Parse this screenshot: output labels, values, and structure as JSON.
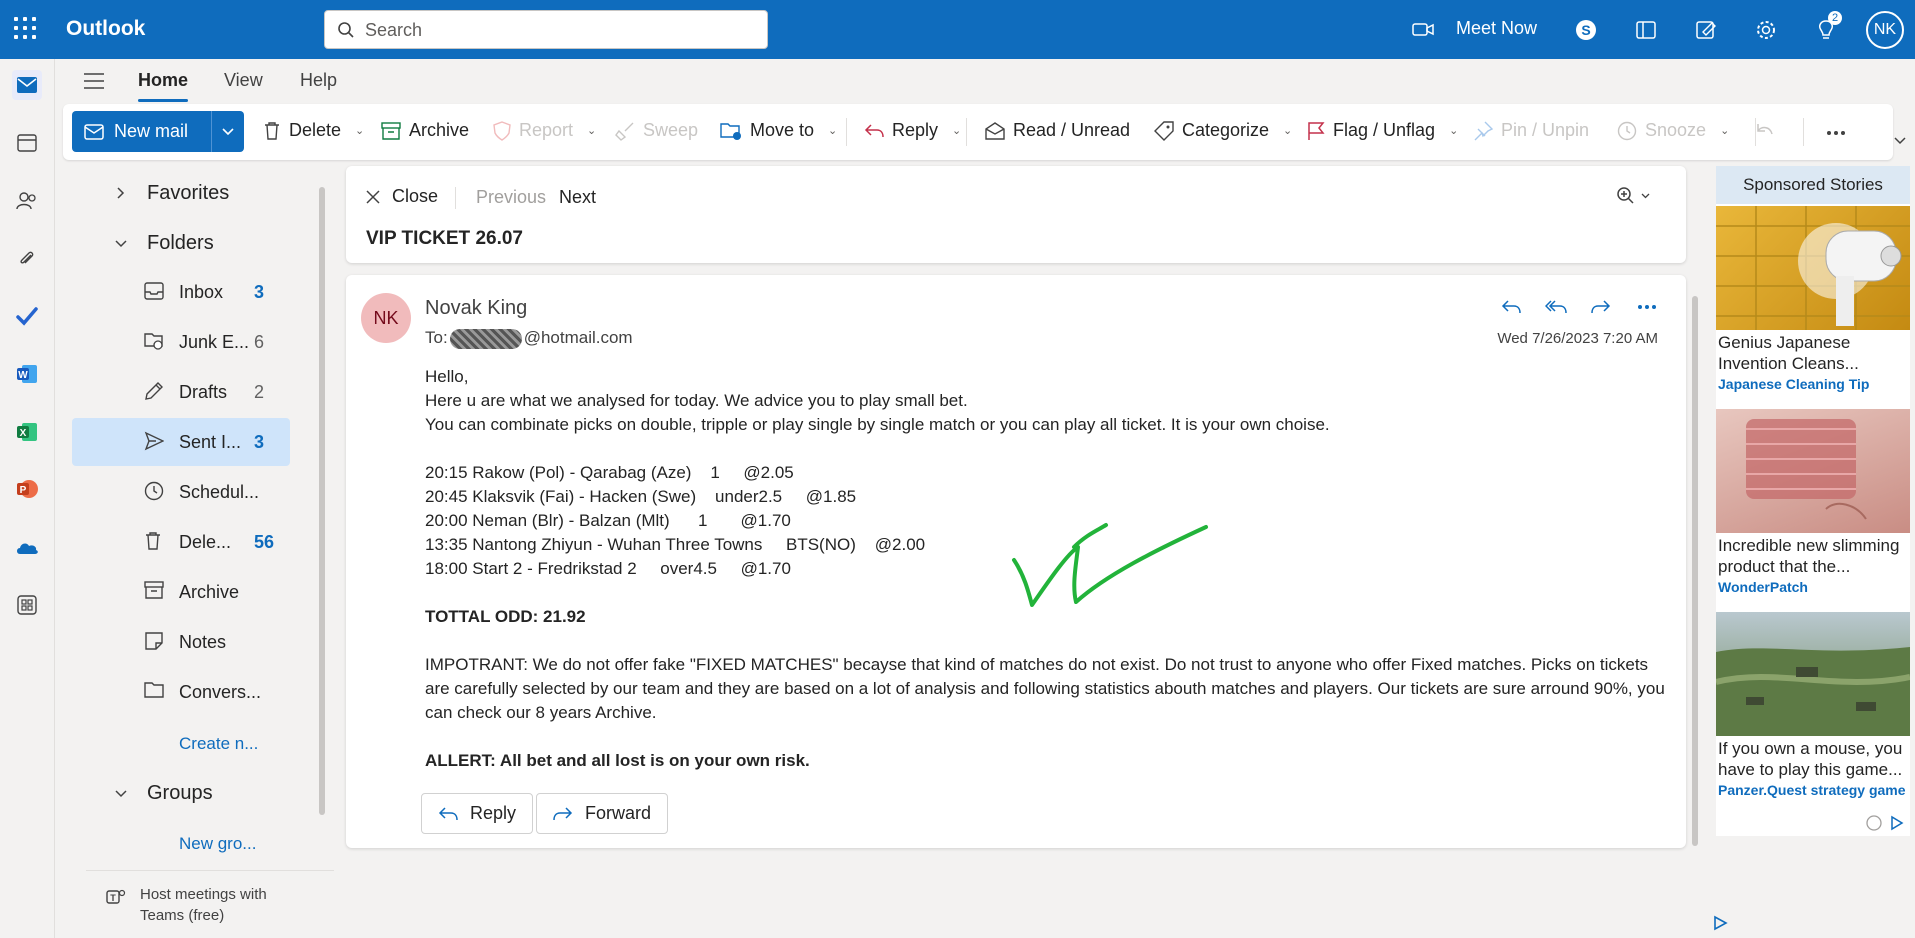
{
  "app": {
    "name": "Outlook"
  },
  "search": {
    "placeholder": "Search"
  },
  "topbar": {
    "meet_now": "Meet Now",
    "notification_count": "2",
    "user_initials": "NK"
  },
  "tabs": [
    "Home",
    "View",
    "Help"
  ],
  "ribbon": {
    "new_mail": "New mail",
    "delete": "Delete",
    "archive": "Archive",
    "report": "Report",
    "sweep": "Sweep",
    "move_to": "Move to",
    "reply": "Reply",
    "read_unread": "Read / Unread",
    "categorize": "Categorize",
    "flag": "Flag / Unflag",
    "pin": "Pin / Unpin",
    "snooze": "Snooze"
  },
  "folders": {
    "favorites": "Favorites",
    "folders_label": "Folders",
    "items": [
      {
        "label": "Inbox",
        "count": "3"
      },
      {
        "label": "Junk E...",
        "count": "6"
      },
      {
        "label": "Drafts",
        "count": "2"
      },
      {
        "label": "Sent I...",
        "count": "3"
      },
      {
        "label": "Schedul...",
        "count": ""
      },
      {
        "label": "Dele...",
        "count": "56"
      },
      {
        "label": "Archive",
        "count": ""
      },
      {
        "label": "Notes",
        "count": ""
      },
      {
        "label": "Convers...",
        "count": ""
      }
    ],
    "create_new": "Create n...",
    "groups": "Groups",
    "new_group": "New gro...",
    "teams_promo_line1": "Host meetings with",
    "teams_promo_line2": "Teams (free)"
  },
  "reading_header": {
    "close": "Close",
    "previous": "Previous",
    "next": "Next",
    "subject": "VIP TICKET 26.07"
  },
  "message": {
    "avatar_initials": "NK",
    "sender": "Novak King",
    "to_prefix": "To:",
    "to_suffix": "@hotmail.com",
    "date": "Wed 7/26/2023 7:20 AM",
    "greeting": "Hello,",
    "line1": "Here u are what we analysed for today. We advice you to play small bet.",
    "line2": "You can combinate picks on double, tripple or play single by single match or you can play all ticket. It is your own choise.",
    "picks": [
      "20:15 Rakow (Pol) - Qarabag (Aze)    1     @2.05",
      "20:45 Klaksvik (Fai) - Hacken (Swe)    under2.5     @1.85",
      "20:00 Neman (Blr) - Balzan (Mlt)      1       @1.70",
      "13:35 Nantong Zhiyun - Wuhan Three Towns     BTS(NO)    @2.00",
      "18:00 Start 2 - Fredrikstad 2     over4.5     @1.70"
    ],
    "total": "TOTTAL ODD: 21.92",
    "important": "IMPOTRANT: We do not offer fake \"FIXED MATCHES\" becayse that kind of matches do not exist. Do not trust to anyone who offer Fixed matches. Picks on tickets are carefully selected by our team and they are based on a lot of analysis and following statistics abouth matches and players. Our tickets are sure arround 90%, you can check our 8 years Archive.",
    "allert": "ALLERT: All bet and all lost is on your own risk.",
    "reply_button": "Reply",
    "forward_button": "Forward"
  },
  "ads": {
    "title": "Sponsored Stories",
    "items": [
      {
        "text": "Genius Japanese Invention Cleans...",
        "source": "Japanese Cleaning Tip"
      },
      {
        "text": "Incredible new slimming product that the...",
        "source": "WonderPatch"
      },
      {
        "text": "If you own a mouse, you have to play this game...",
        "source": "Panzer.Quest strategy game"
      }
    ]
  },
  "colors": {
    "brand": "#0f6cbd",
    "selected": "#cfe4fa",
    "signature": "#22b33a"
  }
}
